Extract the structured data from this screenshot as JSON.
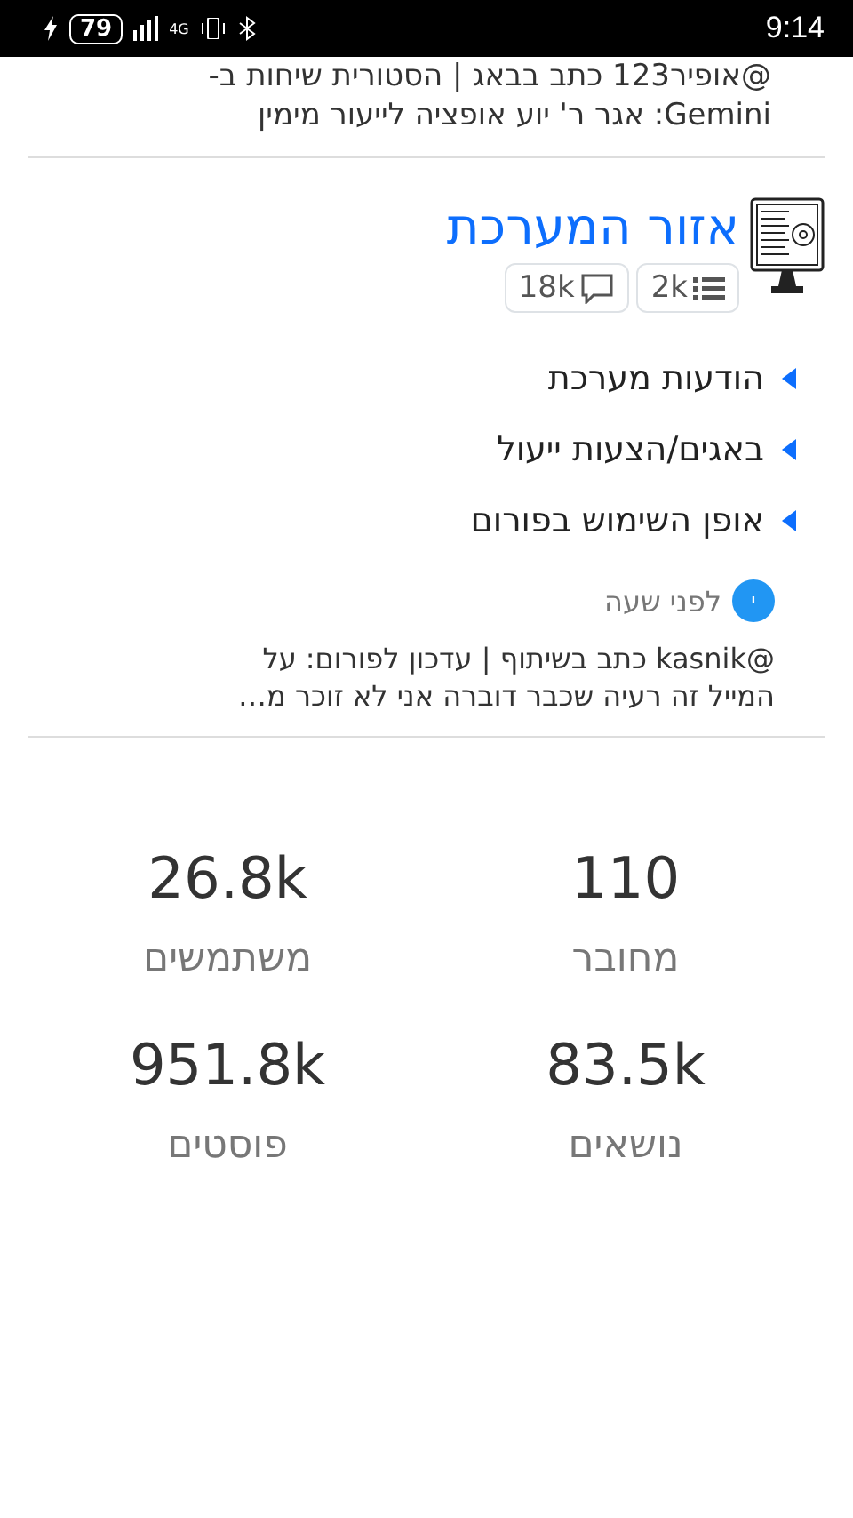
{
  "status_bar": {
    "battery": "79",
    "network": "4G",
    "time": "9:14"
  },
  "top_post": {
    "lines": [
      "@אופיר123 כתב בבאג | הסטורית שיחות ב-",
      "Gemini: אגר ר' יוע אופציה לייעור מימין"
    ]
  },
  "category": {
    "title": "אזור המערכת",
    "topics": "2k",
    "posts": "18k",
    "subcategories": [
      {
        "label": "הודעות מערכת"
      },
      {
        "label": "באגים/הצעות ייעול"
      },
      {
        "label": "אופן השימוש בפורום"
      }
    ],
    "last_post": {
      "avatar": "י",
      "time": "לפני שעה",
      "lines": [
        "@kasnik כתב בשיתוף | עדכון לפורום: על",
        "המייל זה רעיה שכבר דוברה אני לא זוכר מ…"
      ]
    }
  },
  "stats": [
    {
      "value": "110",
      "label": "מחובר"
    },
    {
      "value": "26.8k",
      "label": "משתמשים"
    },
    {
      "value": "83.5k",
      "label": "נושאים"
    },
    {
      "value": "951.8k",
      "label": "פוסטים"
    }
  ]
}
